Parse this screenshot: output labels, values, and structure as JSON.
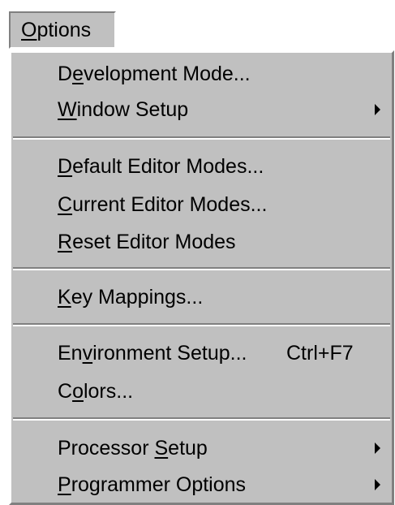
{
  "menu": {
    "title": {
      "mnemonic": "O",
      "rest": "ptions"
    },
    "items": [
      {
        "pre": "D",
        "key": "e",
        "post": "velopment Mode...",
        "shortcut": "",
        "submenu": false
      },
      {
        "pre": "",
        "key": "W",
        "post": "indow Setup",
        "shortcut": "",
        "submenu": true
      },
      {
        "pre": "",
        "key": "D",
        "post": "efault Editor Modes...",
        "shortcut": "",
        "submenu": false
      },
      {
        "pre": "",
        "key": "C",
        "post": "urrent Editor Modes...",
        "shortcut": "",
        "submenu": false
      },
      {
        "pre": "",
        "key": "R",
        "post": "eset Editor Modes",
        "shortcut": "",
        "submenu": false
      },
      {
        "pre": "",
        "key": "K",
        "post": "ey Mappings...",
        "shortcut": "",
        "submenu": false
      },
      {
        "pre": "En",
        "key": "v",
        "post": "ironment Setup...",
        "shortcut": "Ctrl+F7",
        "submenu": false
      },
      {
        "pre": "C",
        "key": "o",
        "post": "lors...",
        "shortcut": "",
        "submenu": false
      },
      {
        "pre": "Processor ",
        "key": "S",
        "post": "etup",
        "shortcut": "",
        "submenu": true
      },
      {
        "pre": "",
        "key": "P",
        "post": "rogrammer Options",
        "shortcut": "",
        "submenu": true
      }
    ]
  }
}
